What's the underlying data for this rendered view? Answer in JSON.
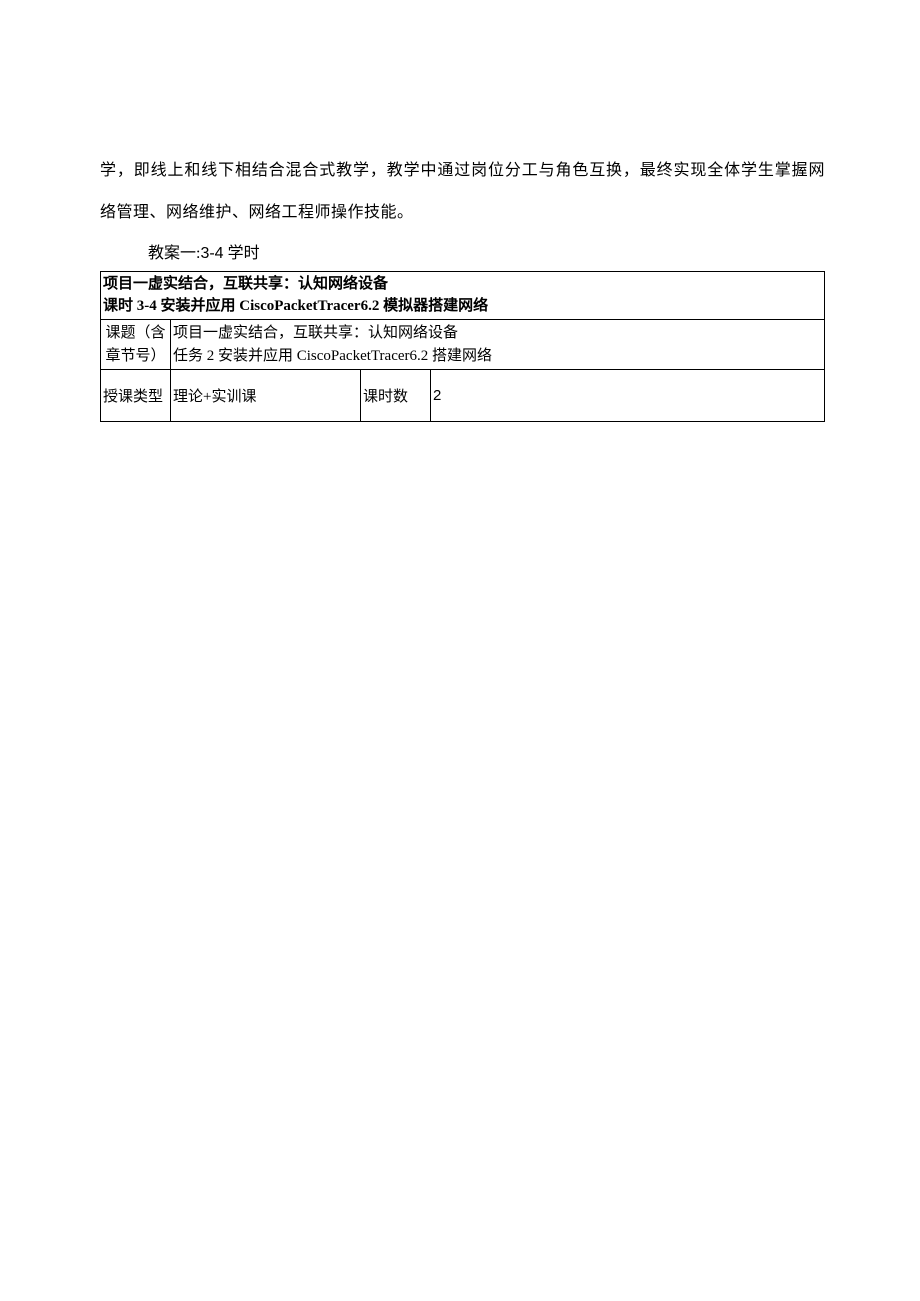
{
  "intro_paragraph": "学，即线上和线下相结合混合式教学，教学中通过岗位分工与角色互换，最终实现全体学生掌握网络管理、网络维护、网络工程师操作技能。",
  "lesson_heading_prefix": "教案一:",
  "lesson_heading_num": "3-4",
  "lesson_heading_suffix": " 学时",
  "table": {
    "header": {
      "line1": "项目一虚实结合，互联共享：认知网络设备",
      "line2": "课时 3-4 安装并应用 CiscoPacketTracer6.2 模拟器搭建网络"
    },
    "row_topic": {
      "label": "课题（含章节号）",
      "value_line1": "项目一虚实结合，互联共享：认知网络设备",
      "value_line2": "任务 2 安装并应用 CiscoPacketTracer6.2 搭建网络"
    },
    "row_type": {
      "label": "授课类型",
      "value": "理论+实训课",
      "hours_label": "课时数",
      "hours_value": "2"
    }
  }
}
